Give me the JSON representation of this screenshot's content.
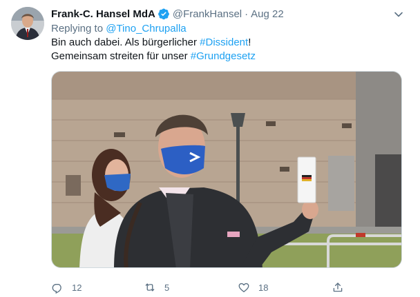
{
  "author": {
    "name": "Frank-C. Hansel MdA",
    "handle": "@FrankHansel",
    "separator": "·",
    "date": "Aug 22"
  },
  "reply": {
    "prefix": "Replying to ",
    "to": "@Tino_Chrupalla"
  },
  "tweet": {
    "line1_text": "Bin auch dabei. Als bürgerlicher ",
    "line1_hashtag": "#Dissident",
    "line1_end": "!",
    "line2_text": "Gemeinsam streiten für unser ",
    "line2_hashtag": "#Grundgesetz"
  },
  "actions": {
    "replies": "12",
    "retweets": "5",
    "likes": "18"
  },
  "colors": {
    "link": "#1da1f2",
    "secondary_text": "#5b7083",
    "verified": "#1da1f2"
  },
  "icons": [
    "verified-badge-icon",
    "chevron-down-icon",
    "reply-icon",
    "retweet-icon",
    "like-icon",
    "share-icon"
  ]
}
